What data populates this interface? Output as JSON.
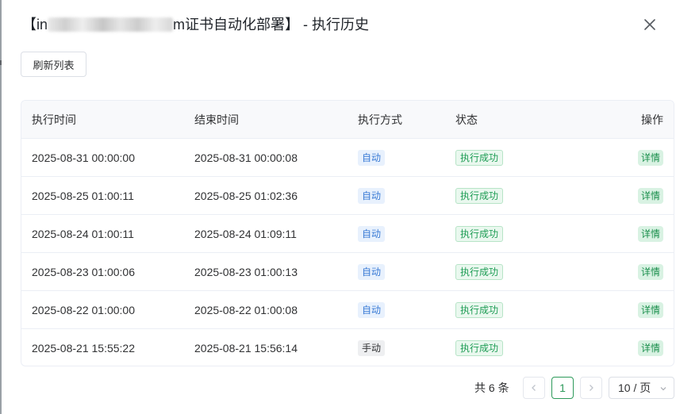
{
  "dialog": {
    "title_prefix": "【in",
    "title_suffix": "m证书自动化部署】 - 执行历史"
  },
  "toolbar": {
    "refresh_label": "刷新列表"
  },
  "table": {
    "headers": [
      "执行时间",
      "结束时间",
      "执行方式",
      "状态",
      "操作"
    ],
    "rows": [
      {
        "start": "2025-08-31 00:00:00",
        "end": "2025-08-31 00:00:08",
        "mode": "自动",
        "status": "执行成功",
        "action": "详情"
      },
      {
        "start": "2025-08-25 01:00:11",
        "end": "2025-08-25 01:02:36",
        "mode": "自动",
        "status": "执行成功",
        "action": "详情"
      },
      {
        "start": "2025-08-24 01:00:11",
        "end": "2025-08-24 01:09:11",
        "mode": "自动",
        "status": "执行成功",
        "action": "详情"
      },
      {
        "start": "2025-08-23 01:00:06",
        "end": "2025-08-23 01:00:13",
        "mode": "自动",
        "status": "执行成功",
        "action": "详情"
      },
      {
        "start": "2025-08-22 01:00:00",
        "end": "2025-08-22 01:00:08",
        "mode": "自动",
        "status": "执行成功",
        "action": "详情"
      },
      {
        "start": "2025-08-21 15:55:22",
        "end": "2025-08-21 15:56:14",
        "mode": "手动",
        "status": "执行成功",
        "action": "详情"
      }
    ]
  },
  "pagination": {
    "total_text": "共 6 条",
    "current_page": "1",
    "page_size_text": "10 / 页"
  },
  "icons": {
    "close": "close-icon",
    "prev": "chevron-left-icon",
    "next": "chevron-right-icon",
    "dropdown": "chevron-down-icon"
  },
  "colors": {
    "auto_tag": "#3a7bd5",
    "success_tag": "#1f9d55",
    "detail_tag": "#1a8f4c",
    "page_active": "#2d9a5a"
  }
}
